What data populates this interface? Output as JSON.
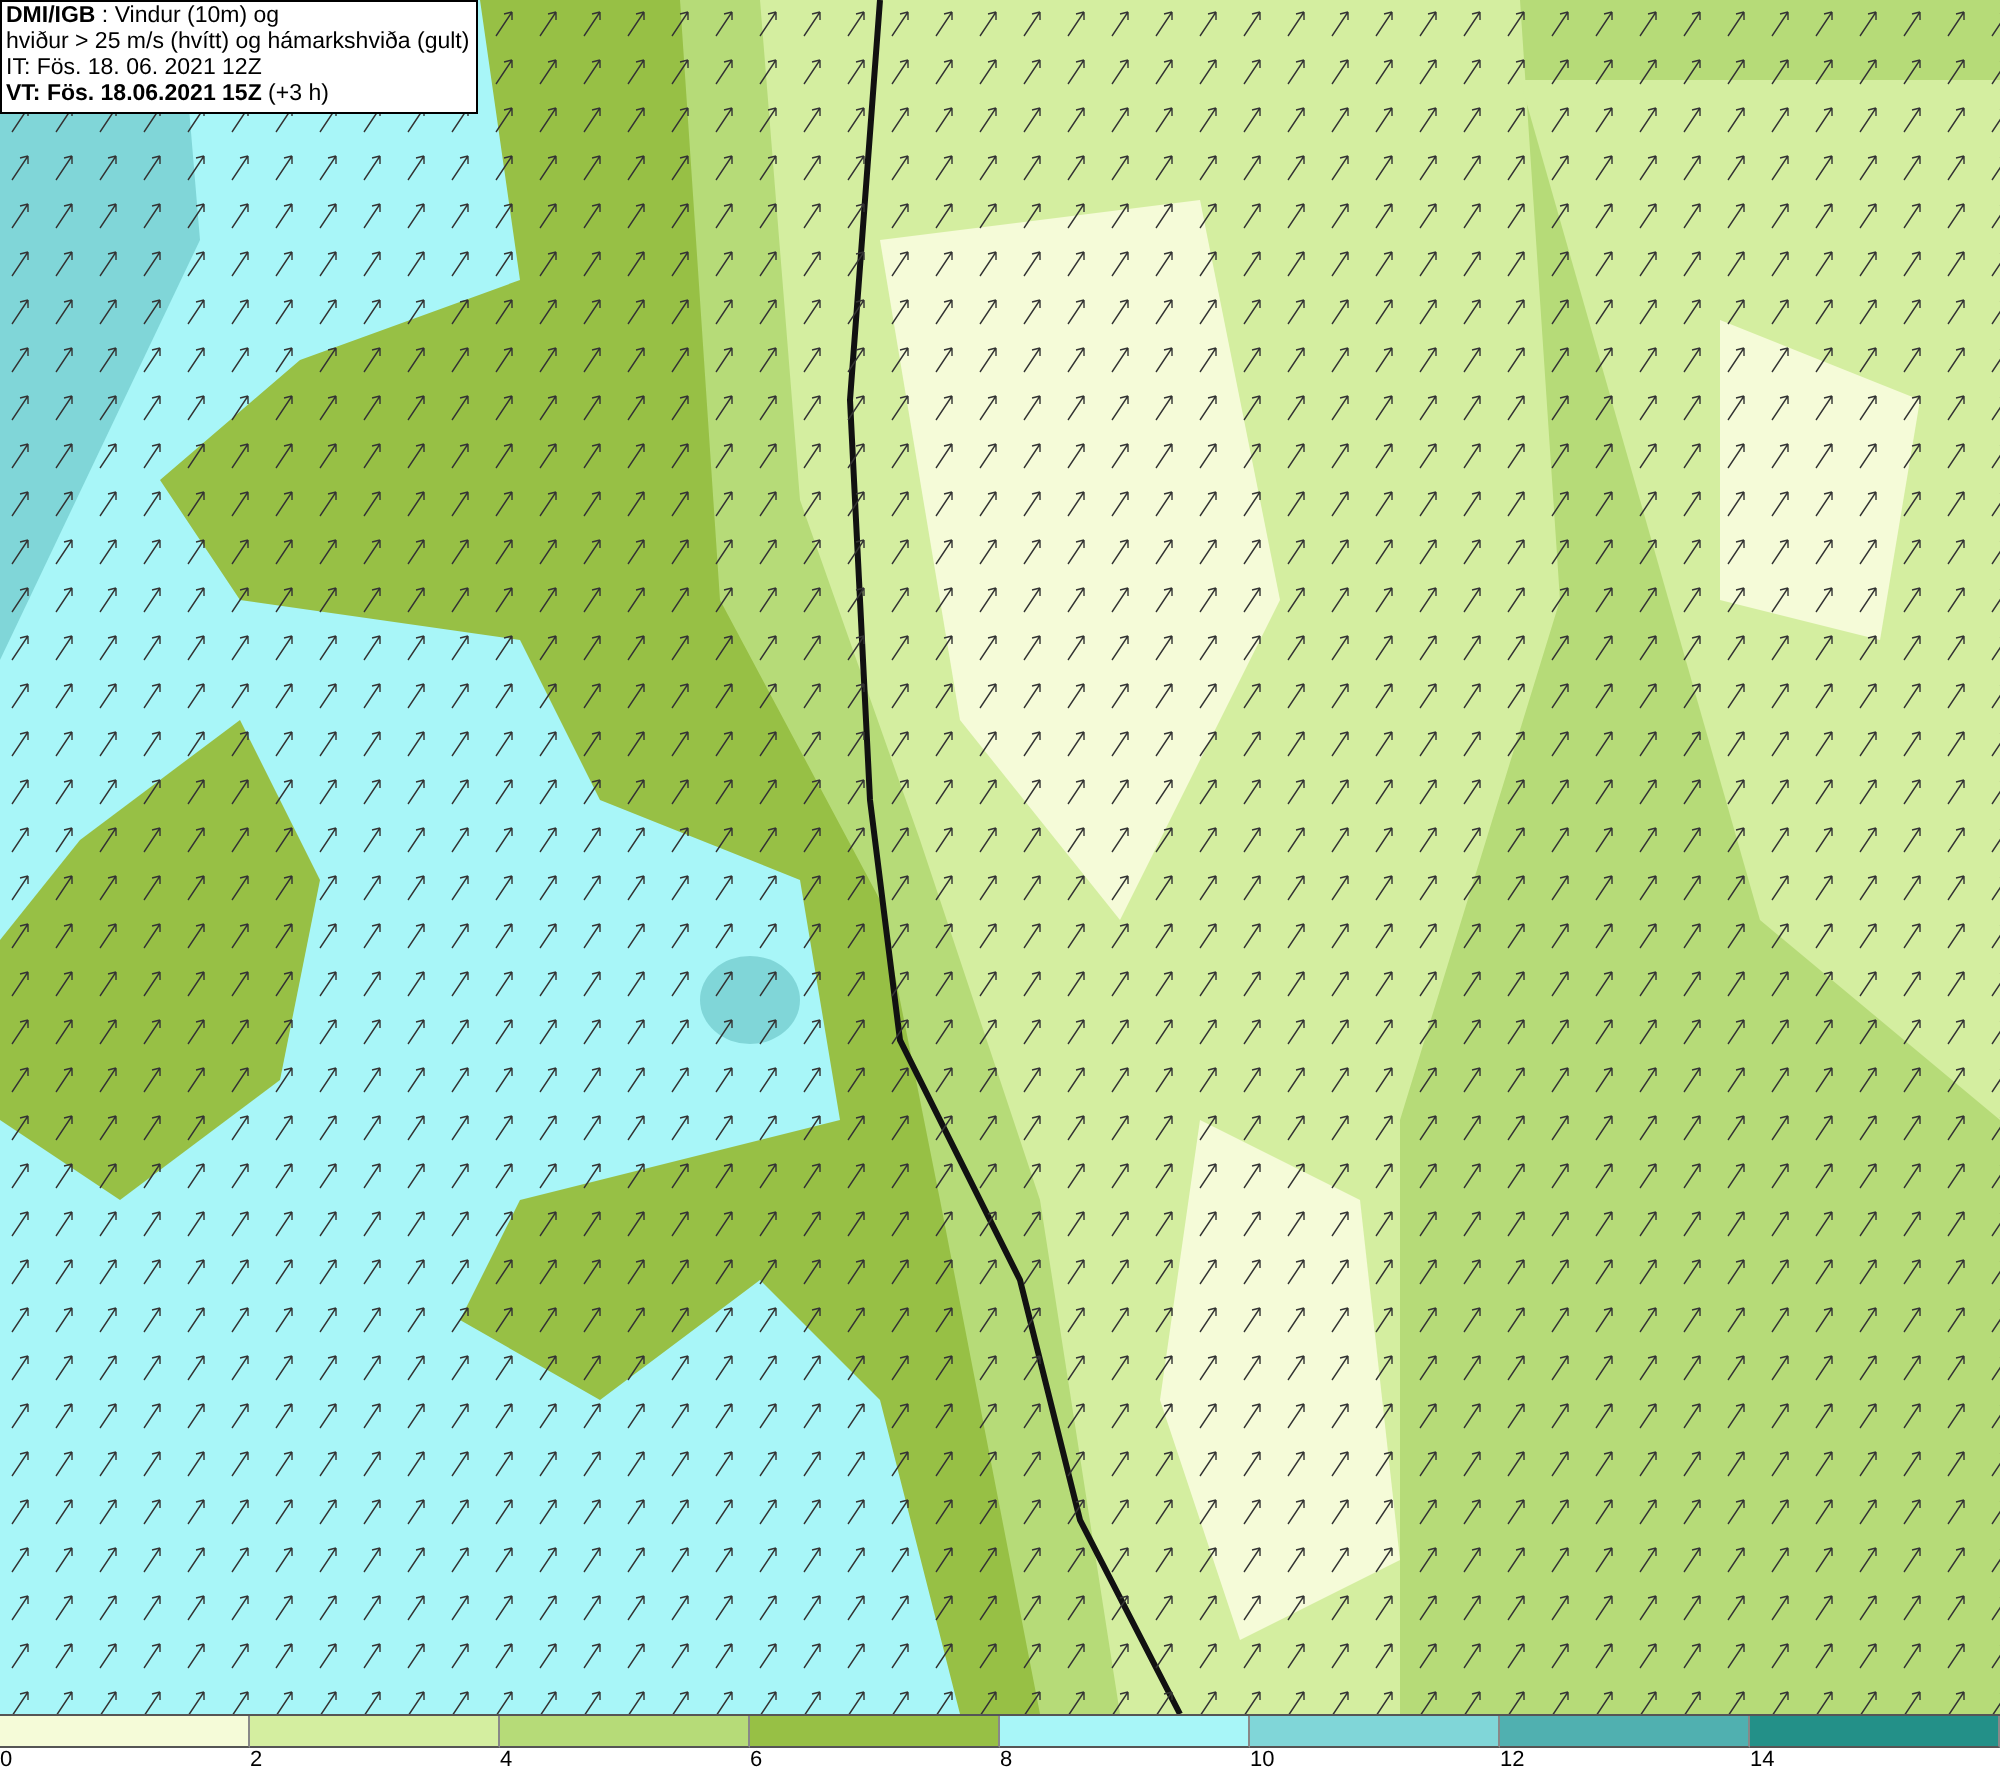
{
  "info": {
    "lines": [
      "**DMI/IGB** : Vindur (10m) og",
      "hviður > 25 m/s (hvítt) og hámarkshviða (gult)",
      "IT: Fös. 18. 06. 2021 12Z",
      "**VT: Fös. 18.06.2021 15Z** (+3 h)"
    ]
  },
  "legend": [
    {
      "label": "0",
      "color": "#f5fbd8"
    },
    {
      "label": "2",
      "color": "#d4eea0"
    },
    {
      "label": "4",
      "color": "#b6db78"
    },
    {
      "label": "6",
      "color": "#97c045"
    },
    {
      "label": "8",
      "color": "#a8f6f8"
    },
    {
      "label": "10",
      "color": "#80d6d8"
    },
    {
      "label": "12",
      "color": "#50b0b0"
    },
    {
      "label": "14",
      "color": "#239088"
    }
  ]
}
